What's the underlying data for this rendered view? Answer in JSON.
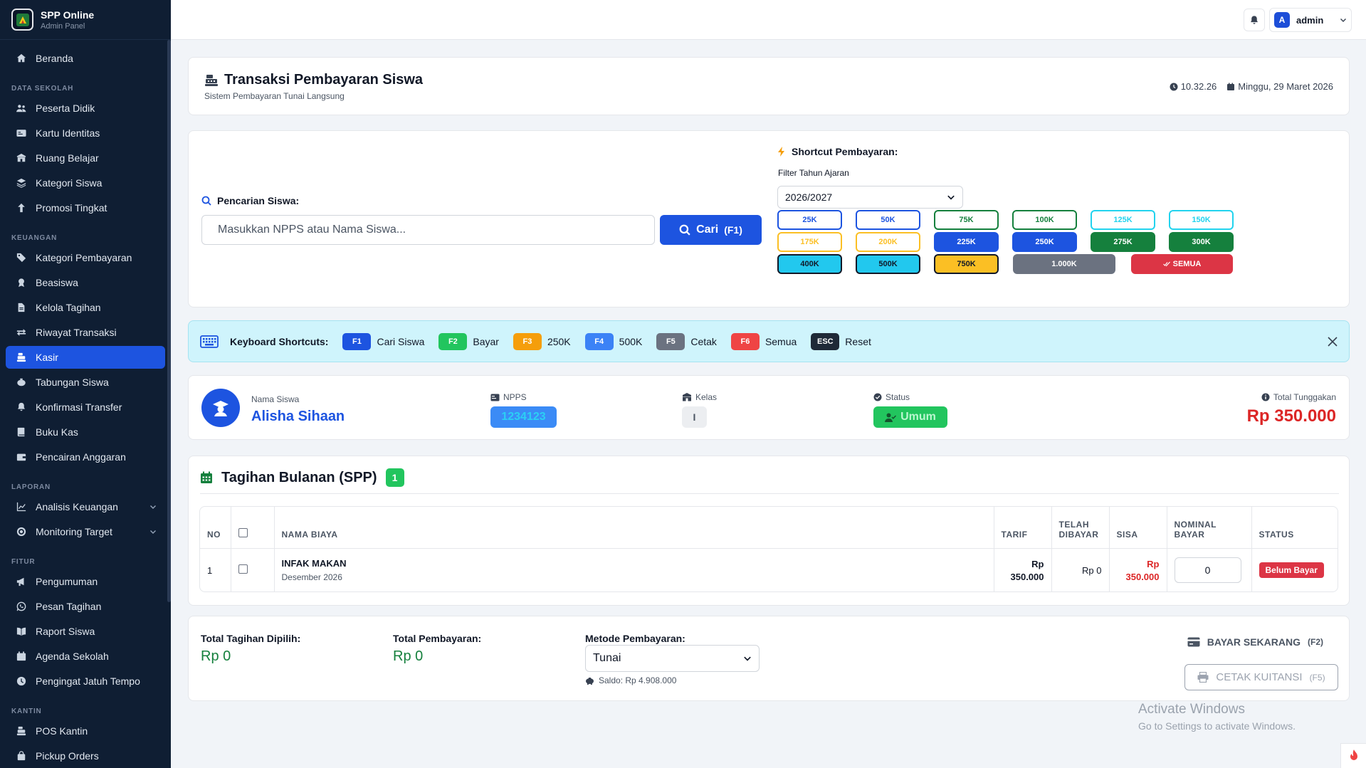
{
  "app": {
    "title": "SPP Online",
    "subtitle": "Admin Panel"
  },
  "sidebar": {
    "items": [
      {
        "label": "Beranda",
        "icon": "home-icon"
      },
      {
        "section": "DATA SEKOLAH"
      },
      {
        "label": "Peserta Didik",
        "icon": "users-icon"
      },
      {
        "label": "Kartu Identitas",
        "icon": "id-card-icon"
      },
      {
        "label": "Ruang Belajar",
        "icon": "school-icon"
      },
      {
        "label": "Kategori Siswa",
        "icon": "layers-icon"
      },
      {
        "label": "Promosi Tingkat",
        "icon": "arrow-up-icon"
      },
      {
        "section": "KEUANGAN"
      },
      {
        "label": "Kategori Pembayaran",
        "icon": "tags-icon"
      },
      {
        "label": "Beasiswa",
        "icon": "award-icon"
      },
      {
        "label": "Kelola Tagihan",
        "icon": "file-icon"
      },
      {
        "label": "Riwayat Transaksi",
        "icon": "exchange-icon"
      },
      {
        "label": "Kasir",
        "icon": "cash-register-icon",
        "active": true
      },
      {
        "label": "Tabungan Siswa",
        "icon": "piggy-bank-icon"
      },
      {
        "label": "Konfirmasi Transfer",
        "icon": "bell-icon"
      },
      {
        "label": "Buku Kas",
        "icon": "book-icon"
      },
      {
        "label": "Pencairan Anggaran",
        "icon": "wallet-icon"
      },
      {
        "section": "LAPORAN"
      },
      {
        "label": "Analisis Keuangan",
        "icon": "chart-line-icon",
        "expandable": true
      },
      {
        "label": "Monitoring Target",
        "icon": "target-icon",
        "expandable": true
      },
      {
        "section": "FITUR"
      },
      {
        "label": "Pengumuman",
        "icon": "megaphone-icon"
      },
      {
        "label": "Pesan Tagihan",
        "icon": "whatsapp-icon"
      },
      {
        "label": "Raport Siswa",
        "icon": "book-open-icon"
      },
      {
        "label": "Agenda Sekolah",
        "icon": "calendar-icon"
      },
      {
        "label": "Pengingat Jatuh Tempo",
        "icon": "clock-icon"
      },
      {
        "section": "KANTIN"
      },
      {
        "label": "POS Kantin",
        "icon": "cash-register-icon"
      },
      {
        "label": "Pickup Orders",
        "icon": "bag-icon"
      }
    ]
  },
  "topbar": {
    "user_initial": "A",
    "user_name": "admin"
  },
  "page": {
    "title": "Transaksi Pembayaran Siswa",
    "subtitle": "Sistem Pembayaran Tunai Langsung",
    "time": "10.32.26",
    "date": "Minggu, 29 Maret 2026"
  },
  "search": {
    "label": "Pencarian Siswa:",
    "placeholder": "Masukkan NPPS atau Nama Siswa...",
    "button_label": "Cari",
    "button_key": "(F1)"
  },
  "shortcut": {
    "title": "Shortcut Pembayaran:",
    "filter_label": "Filter Tahun Ajaran",
    "filter_value": "2026/2027",
    "buttons": [
      {
        "label": "25K",
        "color": "#1d54e0",
        "style": "outline"
      },
      {
        "label": "50K",
        "color": "#1d54e0",
        "style": "outline"
      },
      {
        "label": "75K",
        "color": "#15803d",
        "style": "outline"
      },
      {
        "label": "100K",
        "color": "#15803d",
        "style": "outline"
      },
      {
        "label": "125K",
        "color": "#22d3ee",
        "style": "outline"
      },
      {
        "label": "150K",
        "color": "#22d3ee",
        "style": "outline"
      },
      {
        "label": "175K",
        "color": "#fbbf24",
        "style": "outline"
      },
      {
        "label": "200K",
        "color": "#fbbf24",
        "style": "outline"
      },
      {
        "label": "225K",
        "color": "#1d54e0",
        "style": "solid"
      },
      {
        "label": "250K",
        "color": "#1d54e0",
        "style": "solid"
      },
      {
        "label": "275K",
        "color": "#15803d",
        "style": "solid"
      },
      {
        "label": "300K",
        "color": "#15803d",
        "style": "solid"
      },
      {
        "label": "400K",
        "color": "#22c8ee",
        "style": "solid-dark"
      },
      {
        "label": "500K",
        "color": "#22c8ee",
        "style": "solid-dark"
      },
      {
        "label": "750K",
        "color": "#fbbf24",
        "style": "solid-dark"
      },
      {
        "label": "1.000K",
        "color": "#6b7280",
        "style": "solid"
      },
      {
        "label": "SEMUA",
        "color": "#dc3545",
        "style": "solid"
      }
    ]
  },
  "keyboard": {
    "label": "Keyboard Shortcuts:",
    "items": [
      {
        "key": "F1",
        "desc": "Cari Siswa",
        "color": "#1d54e0"
      },
      {
        "key": "F2",
        "desc": "Bayar",
        "color": "#22c55e"
      },
      {
        "key": "F3",
        "desc": "250K",
        "color": "#f59e0b"
      },
      {
        "key": "F4",
        "desc": "500K",
        "color": "#3b82f6"
      },
      {
        "key": "F5",
        "desc": "Cetak",
        "color": "#6b7280"
      },
      {
        "key": "F6",
        "desc": "Semua",
        "color": "#ef4444"
      },
      {
        "key": "ESC",
        "desc": "Reset",
        "color": "#1f2937"
      }
    ]
  },
  "student": {
    "name_label": "Nama Siswa",
    "name": "Alisha Sihaan",
    "npps_label": "NPPS",
    "npps": "1234123",
    "kelas_label": "Kelas",
    "kelas": "I",
    "status_label": "Status",
    "status": "Umum",
    "tunggakan_label": "Total Tunggakan",
    "tunggakan": "Rp 350.000"
  },
  "billing": {
    "title": "Tagihan Bulanan (SPP)",
    "count": "1",
    "columns": {
      "no": "NO",
      "name": "NAMA BIAYA",
      "tarif": "TARIF",
      "paid_1": "TELAH",
      "paid_2": "DIBAYAR",
      "sisa": "SISA",
      "nominal_1": "NOMINAL",
      "nominal_2": "BAYAR",
      "status": "STATUS"
    },
    "rows": [
      {
        "no": "1",
        "name": "INFAK MAKAN",
        "period": "Desember 2026",
        "tarif_1": "Rp",
        "tarif_2": "350.000",
        "paid": "Rp 0",
        "sisa_1": "Rp",
        "sisa_2": "350.000",
        "nominal": "0",
        "status": "Belum Bayar"
      }
    ]
  },
  "summary": {
    "selected_label": "Total Tagihan Dipilih:",
    "selected_value": "Rp 0",
    "payment_label": "Total Pembayaran:",
    "payment_value": "Rp 0",
    "method_label": "Metode Pembayaran:",
    "method_value": "Tunai",
    "saldo": "Saldo: Rp 4.908.000",
    "pay_button": "BAYAR SEKARANG",
    "pay_key": "(F2)",
    "print_button": "CETAK KUITANSI",
    "print_key": "(F5)"
  },
  "watermark": {
    "line1": "Activate Windows",
    "line2": "Go to Settings to activate Windows."
  }
}
